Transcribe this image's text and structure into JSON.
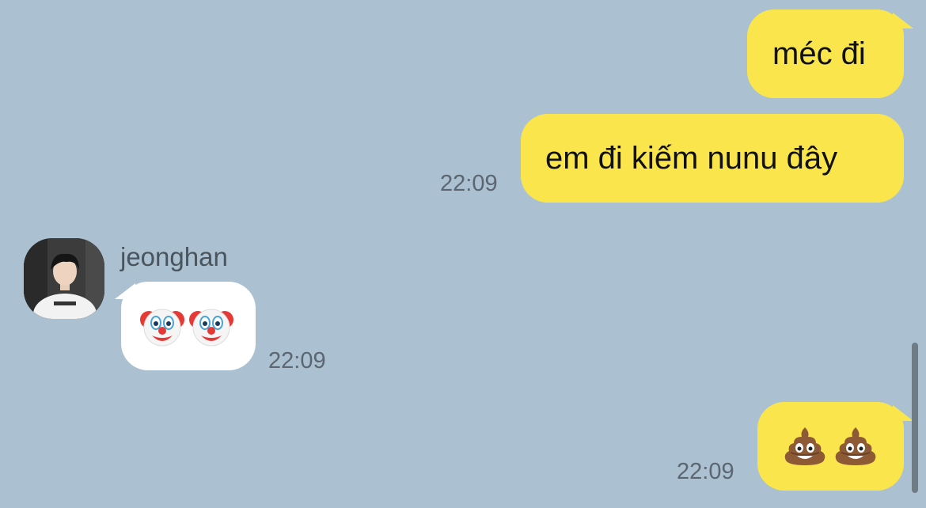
{
  "messages": [
    {
      "id": "m1",
      "from": "me",
      "text": "méc đi"
    },
    {
      "id": "m2",
      "from": "me",
      "text": "em đi kiếm nunu đây",
      "time": "22:09"
    },
    {
      "id": "m3",
      "from": "them",
      "sender": "jeonghan",
      "emoji": [
        "clown-face",
        "clown-face"
      ],
      "time": "22:09"
    },
    {
      "id": "m4",
      "from": "me",
      "emoji": [
        "pile-of-poo",
        "pile-of-poo"
      ],
      "time": "22:09"
    }
  ],
  "colors": {
    "background": "#abc1d1",
    "my_bubble": "#fae64c",
    "their_bubble": "#ffffff",
    "timestamp": "#5b6670"
  }
}
